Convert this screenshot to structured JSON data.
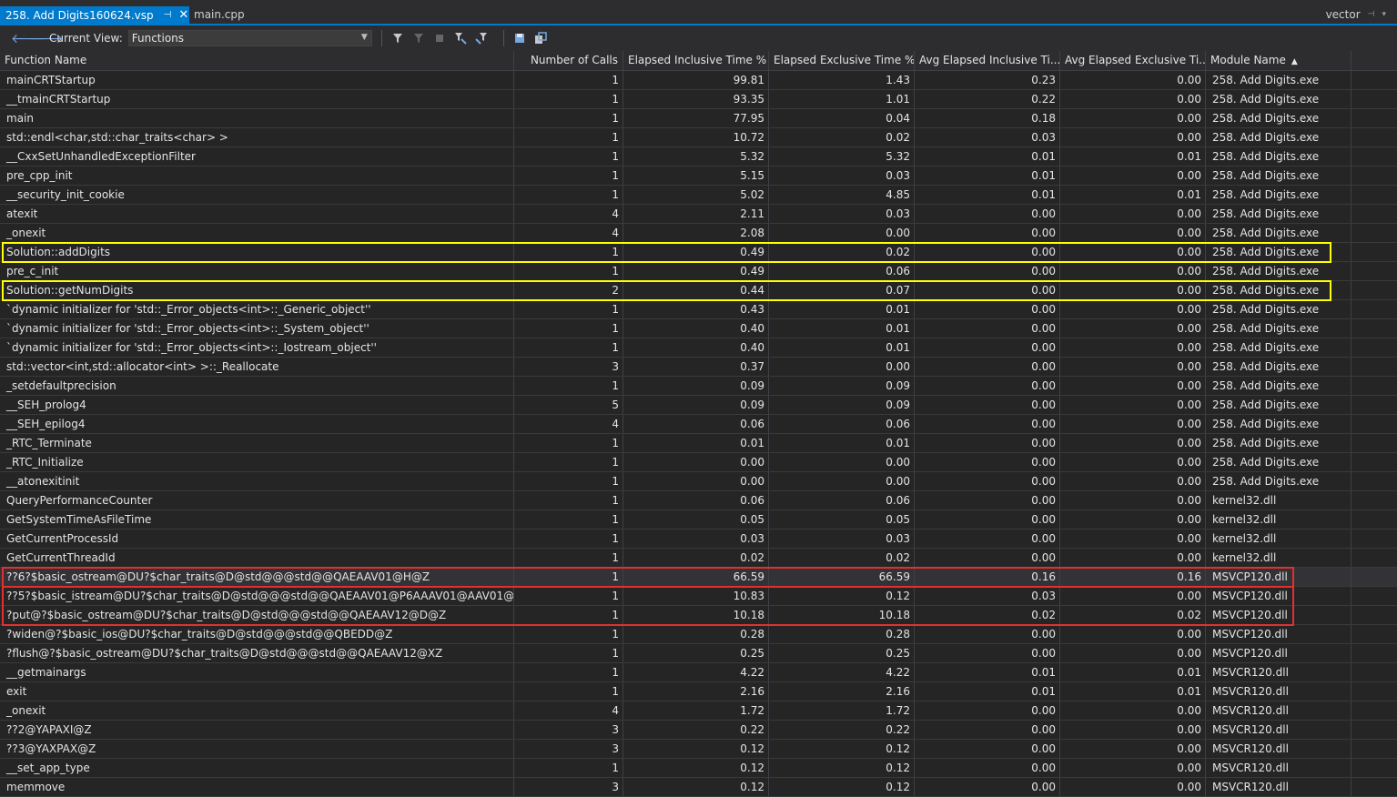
{
  "tabs": {
    "active_label": "258. Add Digits160624.vsp",
    "pin_glyph": "⊣",
    "close_glyph": "✕",
    "inactive_label": "main.cpp",
    "right_label": "vector"
  },
  "toolbar": {
    "current_view_label": "Current View:",
    "view_value": "Functions",
    "icons": [
      "back-arrow-icon",
      "forward-arrow-icon",
      "filter-icon",
      "clear-filter-icon",
      "stop-icon",
      "filter-caller-icon",
      "filter-callee-icon",
      "save-icon",
      "export-icon"
    ]
  },
  "columns": [
    "Function Name",
    "Number of Calls",
    "Elapsed Inclusive Time %",
    "Elapsed Exclusive Time %",
    "Avg Elapsed Inclusive Ti...",
    "Avg Elapsed Exclusive Ti...",
    "Module Name"
  ],
  "sort_column": "Module Name",
  "sort_direction": "ascending",
  "rows": [
    [
      "mainCRTStartup",
      "1",
      "99.81",
      "1.43",
      "0.23",
      "0.00",
      "258. Add Digits.exe"
    ],
    [
      "__tmainCRTStartup",
      "1",
      "93.35",
      "1.01",
      "0.22",
      "0.00",
      "258. Add Digits.exe"
    ],
    [
      "main",
      "1",
      "77.95",
      "0.04",
      "0.18",
      "0.00",
      "258. Add Digits.exe"
    ],
    [
      "std::endl<char,std::char_traits<char> >",
      "1",
      "10.72",
      "0.02",
      "0.03",
      "0.00",
      "258. Add Digits.exe"
    ],
    [
      "__CxxSetUnhandledExceptionFilter",
      "1",
      "5.32",
      "5.32",
      "0.01",
      "0.01",
      "258. Add Digits.exe"
    ],
    [
      "pre_cpp_init",
      "1",
      "5.15",
      "0.03",
      "0.01",
      "0.00",
      "258. Add Digits.exe"
    ],
    [
      "__security_init_cookie",
      "1",
      "5.02",
      "4.85",
      "0.01",
      "0.01",
      "258. Add Digits.exe"
    ],
    [
      "atexit",
      "4",
      "2.11",
      "0.03",
      "0.00",
      "0.00",
      "258. Add Digits.exe"
    ],
    [
      "_onexit",
      "4",
      "2.08",
      "0.00",
      "0.00",
      "0.00",
      "258. Add Digits.exe"
    ],
    [
      "Solution::addDigits",
      "1",
      "0.49",
      "0.02",
      "0.00",
      "0.00",
      "258. Add Digits.exe"
    ],
    [
      "pre_c_init",
      "1",
      "0.49",
      "0.06",
      "0.00",
      "0.00",
      "258. Add Digits.exe"
    ],
    [
      "Solution::getNumDigits",
      "2",
      "0.44",
      "0.07",
      "0.00",
      "0.00",
      "258. Add Digits.exe"
    ],
    [
      "`dynamic initializer for 'std::_Error_objects<int>::_Generic_object''",
      "1",
      "0.43",
      "0.01",
      "0.00",
      "0.00",
      "258. Add Digits.exe"
    ],
    [
      "`dynamic initializer for 'std::_Error_objects<int>::_System_object''",
      "1",
      "0.40",
      "0.01",
      "0.00",
      "0.00",
      "258. Add Digits.exe"
    ],
    [
      "`dynamic initializer for 'std::_Error_objects<int>::_Iostream_object''",
      "1",
      "0.40",
      "0.01",
      "0.00",
      "0.00",
      "258. Add Digits.exe"
    ],
    [
      "std::vector<int,std::allocator<int> >::_Reallocate",
      "3",
      "0.37",
      "0.00",
      "0.00",
      "0.00",
      "258. Add Digits.exe"
    ],
    [
      "_setdefaultprecision",
      "1",
      "0.09",
      "0.09",
      "0.00",
      "0.00",
      "258. Add Digits.exe"
    ],
    [
      "__SEH_prolog4",
      "5",
      "0.09",
      "0.09",
      "0.00",
      "0.00",
      "258. Add Digits.exe"
    ],
    [
      "__SEH_epilog4",
      "4",
      "0.06",
      "0.06",
      "0.00",
      "0.00",
      "258. Add Digits.exe"
    ],
    [
      "_RTC_Terminate",
      "1",
      "0.01",
      "0.01",
      "0.00",
      "0.00",
      "258. Add Digits.exe"
    ],
    [
      "_RTC_Initialize",
      "1",
      "0.00",
      "0.00",
      "0.00",
      "0.00",
      "258. Add Digits.exe"
    ],
    [
      "__atonexitinit",
      "1",
      "0.00",
      "0.00",
      "0.00",
      "0.00",
      "258. Add Digits.exe"
    ],
    [
      "QueryPerformanceCounter",
      "1",
      "0.06",
      "0.06",
      "0.00",
      "0.00",
      "kernel32.dll"
    ],
    [
      "GetSystemTimeAsFileTime",
      "1",
      "0.05",
      "0.05",
      "0.00",
      "0.00",
      "kernel32.dll"
    ],
    [
      "GetCurrentProcessId",
      "1",
      "0.03",
      "0.03",
      "0.00",
      "0.00",
      "kernel32.dll"
    ],
    [
      "GetCurrentThreadId",
      "1",
      "0.02",
      "0.02",
      "0.00",
      "0.00",
      "kernel32.dll"
    ],
    [
      "??6?$basic_ostream@DU?$char_traits@D@std@@@std@@QAEAAV01@H@Z",
      "1",
      "66.59",
      "66.59",
      "0.16",
      "0.16",
      "MSVCP120.dll"
    ],
    [
      "??5?$basic_istream@DU?$char_traits@D@std@@@std@@QAEAAV01@P6AAAV01@AAV01@@Z@Z",
      "1",
      "10.83",
      "0.12",
      "0.03",
      "0.00",
      "MSVCP120.dll"
    ],
    [
      "?put@?$basic_ostream@DU?$char_traits@D@std@@@std@@QAEAAV12@D@Z",
      "1",
      "10.18",
      "10.18",
      "0.02",
      "0.02",
      "MSVCP120.dll"
    ],
    [
      "?widen@?$basic_ios@DU?$char_traits@D@std@@@std@@QBEDD@Z",
      "1",
      "0.28",
      "0.28",
      "0.00",
      "0.00",
      "MSVCP120.dll"
    ],
    [
      "?flush@?$basic_ostream@DU?$char_traits@D@std@@@std@@QAEAAV12@XZ",
      "1",
      "0.25",
      "0.25",
      "0.00",
      "0.00",
      "MSVCP120.dll"
    ],
    [
      "__getmainargs",
      "1",
      "4.22",
      "4.22",
      "0.01",
      "0.01",
      "MSVCR120.dll"
    ],
    [
      "exit",
      "1",
      "2.16",
      "2.16",
      "0.01",
      "0.01",
      "MSVCR120.dll"
    ],
    [
      "_onexit",
      "4",
      "1.72",
      "1.72",
      "0.00",
      "0.00",
      "MSVCR120.dll"
    ],
    [
      "??2@YAPAXI@Z",
      "3",
      "0.22",
      "0.22",
      "0.00",
      "0.00",
      "MSVCR120.dll"
    ],
    [
      "??3@YAXPAX@Z",
      "3",
      "0.12",
      "0.12",
      "0.00",
      "0.00",
      "MSVCR120.dll"
    ],
    [
      "__set_app_type",
      "1",
      "0.12",
      "0.12",
      "0.00",
      "0.00",
      "MSVCR120.dll"
    ],
    [
      "memmove",
      "3",
      "0.12",
      "0.12",
      "0.00",
      "0.00",
      "MSVCR120.dll"
    ]
  ],
  "selected_row": 26,
  "highlights": {
    "yellow_rows": [
      9,
      11
    ],
    "red_rows": [
      26,
      27,
      28
    ],
    "yellow_color": "#ffff00",
    "red_color": "#e03030"
  }
}
